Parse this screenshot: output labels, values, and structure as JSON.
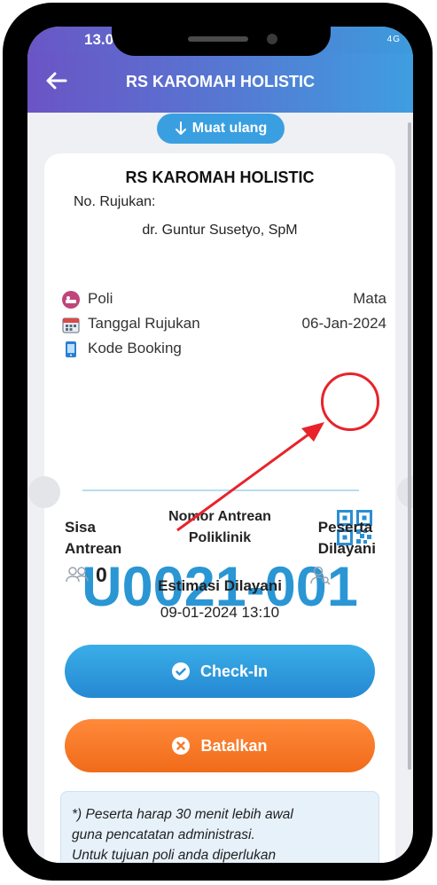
{
  "status_bar": {
    "time": "13.0",
    "signal": "4G"
  },
  "app_bar": {
    "title": "RS KAROMAH HOLISTIC",
    "back_icon": "arrow-left-icon"
  },
  "reload_button": {
    "label": "Muat ulang",
    "icon": "arrow-down-icon"
  },
  "card": {
    "hospital": "RS KAROMAH HOLISTIC",
    "referral_label": "No. Rujukan:",
    "doctor": "dr. Guntur Susetyo, SpM",
    "rows": [
      {
        "label": "Poli",
        "value": "Mata",
        "icon": "clinic-icon"
      },
      {
        "label": "Tanggal Rujukan",
        "value": "06-Jan-2024",
        "icon": "calendar-icon"
      },
      {
        "label": "Kode Booking",
        "value": "",
        "icon": "phone-icon"
      }
    ],
    "queue_label_line1": "Nomor Antrean",
    "queue_label_line2": "Poliklinik",
    "queue_number": "U0021-001",
    "remaining_label_line1": "Sisa",
    "remaining_label_line2": "Antrean",
    "remaining_value": "0",
    "served_label_line1": "Peserta",
    "served_label_line2": "Dilayani",
    "estimate_label": "Estimasi Dilayani",
    "estimate_value": "09-01-2024 13:10",
    "checkin_label": "Check-In",
    "cancel_label": "Batalkan",
    "note_line1": "*) Peserta harap 30 menit lebih awal",
    "note_line2": "guna pencatatan administrasi.",
    "note_line3": "Untuk tujuan poli anda diperlukan"
  },
  "colors": {
    "accent": "#2a96d4",
    "checkin": "#2a95dc",
    "cancel": "#f57a2a",
    "annotation": "#e8232a"
  }
}
